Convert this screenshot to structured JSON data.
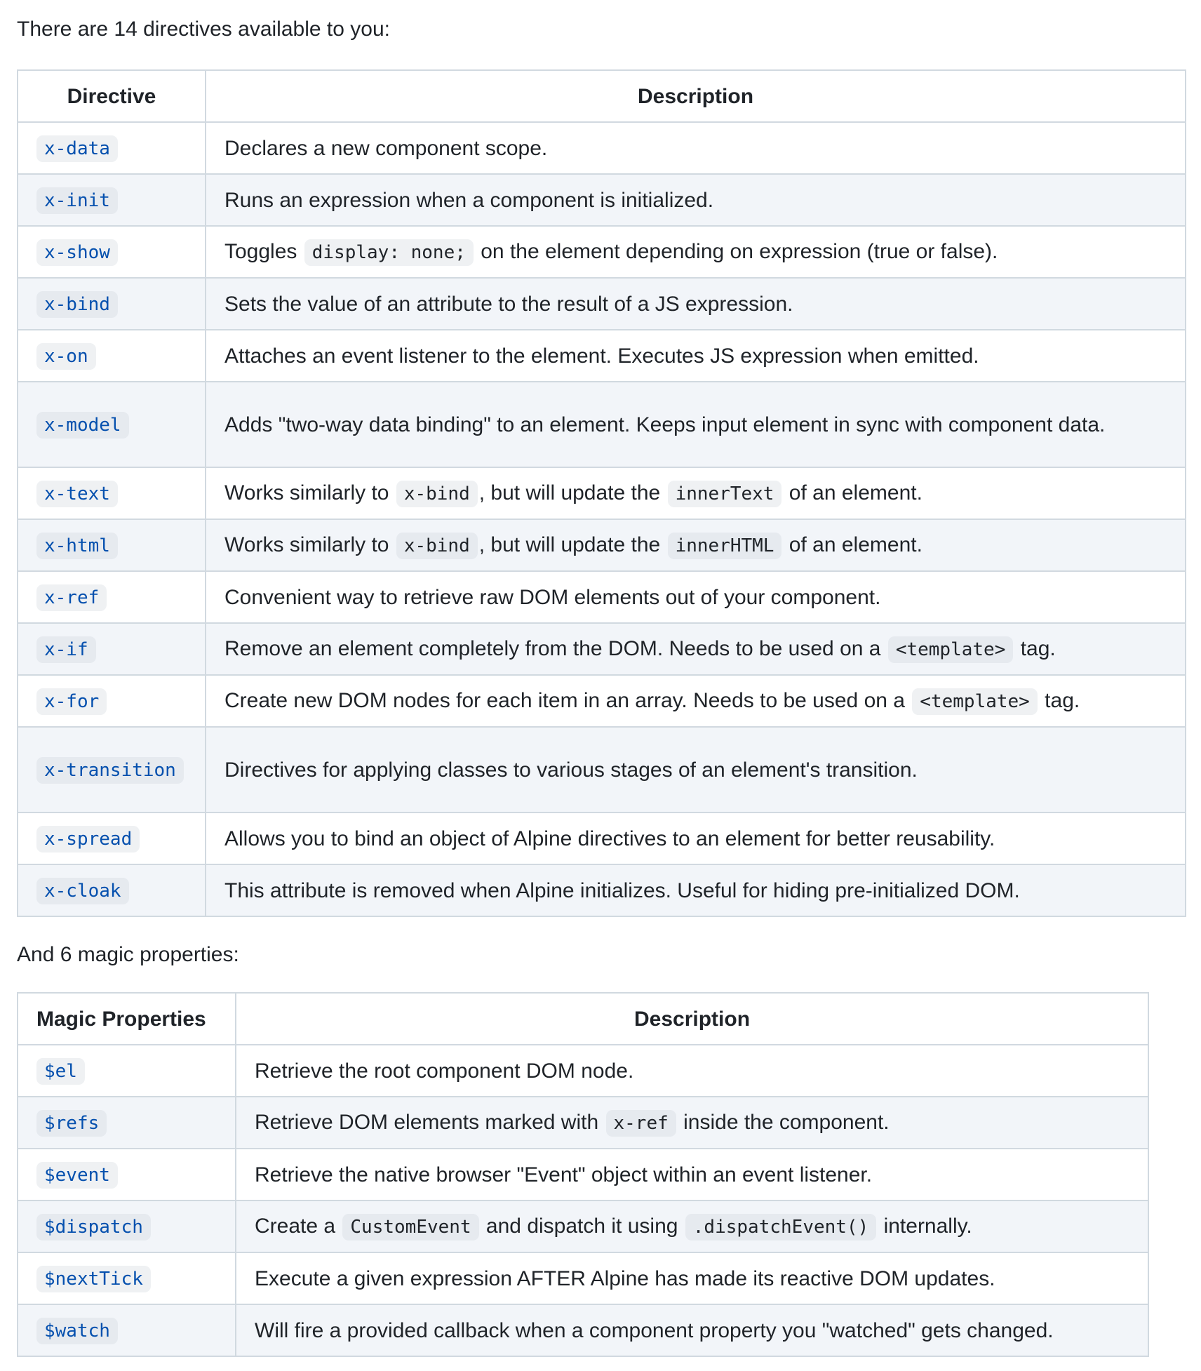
{
  "intro": "There are 14 directives available to you:",
  "directives_table": {
    "headers": [
      "Directive",
      "Description"
    ],
    "rows": [
      {
        "key": "x-data",
        "parts": [
          {
            "t": "Declares a new component scope."
          }
        ]
      },
      {
        "key": "x-init",
        "parts": [
          {
            "t": "Runs an expression when a component is initialized."
          }
        ]
      },
      {
        "key": "x-show",
        "parts": [
          {
            "t": "Toggles "
          },
          {
            "c": "display: none;"
          },
          {
            "t": " on the element depending on expression (true or false)."
          }
        ]
      },
      {
        "key": "x-bind",
        "parts": [
          {
            "t": "Sets the value of an attribute to the result of a JS expression."
          }
        ]
      },
      {
        "key": "x-on",
        "parts": [
          {
            "t": "Attaches an event listener to the element. Executes JS expression when emitted."
          }
        ]
      },
      {
        "key": "x-model",
        "parts": [
          {
            "t": "Adds \"two-way data binding\" to an element. Keeps input element in sync with component data."
          }
        ]
      },
      {
        "key": "x-text",
        "parts": [
          {
            "t": "Works similarly to "
          },
          {
            "c": "x-bind"
          },
          {
            "t": ", but will update the "
          },
          {
            "c": "innerText"
          },
          {
            "t": " of an element."
          }
        ]
      },
      {
        "key": "x-html",
        "parts": [
          {
            "t": "Works similarly to "
          },
          {
            "c": "x-bind"
          },
          {
            "t": ", but will update the "
          },
          {
            "c": "innerHTML"
          },
          {
            "t": " of an element."
          }
        ]
      },
      {
        "key": "x-ref",
        "parts": [
          {
            "t": "Convenient way to retrieve raw DOM elements out of your component."
          }
        ]
      },
      {
        "key": "x-if",
        "parts": [
          {
            "t": "Remove an element completely from the DOM. Needs to be used on a "
          },
          {
            "c": "<template>"
          },
          {
            "t": " tag."
          }
        ]
      },
      {
        "key": "x-for",
        "parts": [
          {
            "t": "Create new DOM nodes for each item in an array. Needs to be used on a "
          },
          {
            "c": "<template>"
          },
          {
            "t": " tag."
          }
        ]
      },
      {
        "key": "x-transition",
        "parts": [
          {
            "t": "Directives for applying classes to various stages of an element's transition."
          }
        ]
      },
      {
        "key": "x-spread",
        "parts": [
          {
            "t": "Allows you to bind an object of Alpine directives to an element for better reusability."
          }
        ]
      },
      {
        "key": "x-cloak",
        "parts": [
          {
            "t": "This attribute is removed when Alpine initializes. Useful for hiding pre-initialized DOM."
          }
        ]
      }
    ]
  },
  "magic_intro": "And 6 magic properties:",
  "magic_table": {
    "headers": [
      "Magic Properties",
      "Description"
    ],
    "rows": [
      {
        "key": "$el",
        "parts": [
          {
            "t": "Retrieve the root component DOM node."
          }
        ]
      },
      {
        "key": "$refs",
        "parts": [
          {
            "t": "Retrieve DOM elements marked with "
          },
          {
            "c": "x-ref"
          },
          {
            "t": " inside the component."
          }
        ]
      },
      {
        "key": "$event",
        "parts": [
          {
            "t": "Retrieve the native browser \"Event\" object within an event listener."
          }
        ]
      },
      {
        "key": "$dispatch",
        "parts": [
          {
            "t": "Create a "
          },
          {
            "c": "CustomEvent"
          },
          {
            "t": " and dispatch it using "
          },
          {
            "c": ".dispatchEvent()"
          },
          {
            "t": " internally."
          }
        ]
      },
      {
        "key": "$nextTick",
        "parts": [
          {
            "t": "Execute a given expression AFTER Alpine has made its reactive DOM updates."
          }
        ]
      },
      {
        "key": "$watch",
        "parts": [
          {
            "t": "Will fire a provided callback when a component property you \"watched\" gets changed."
          }
        ]
      }
    ]
  },
  "colors": {
    "text": "#1f2328",
    "code_key": "#0550ae",
    "code_bg": "#eff1f3",
    "row_alt_bg": "#f2f5f9",
    "border": "#d1d9e0"
  }
}
